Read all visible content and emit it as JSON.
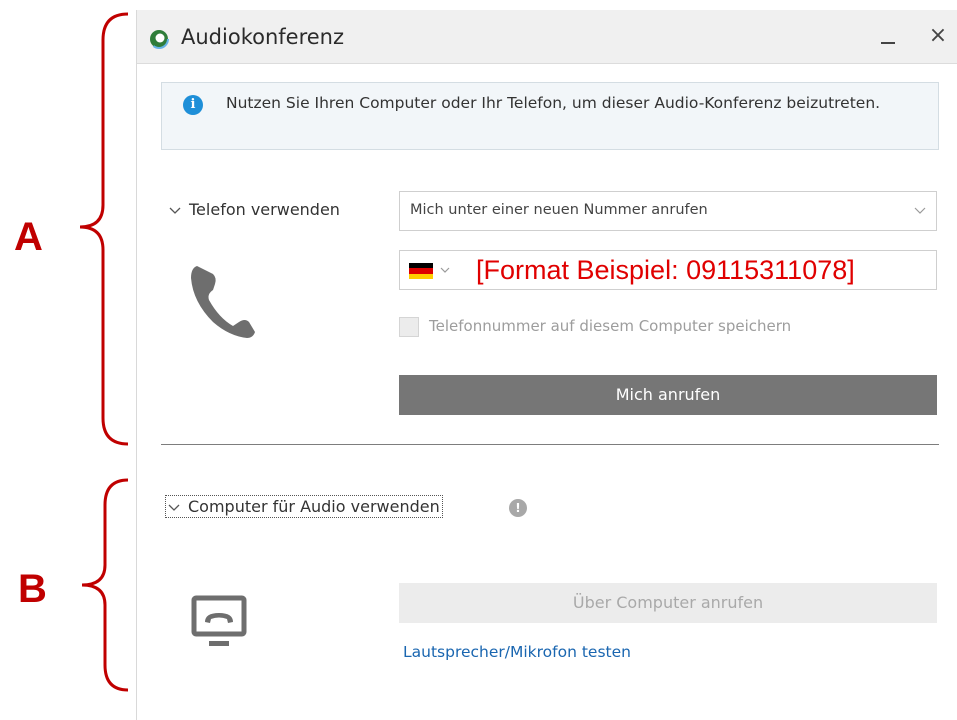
{
  "annotations": {
    "label_a": "A",
    "label_b": "B",
    "color": "#c00000"
  },
  "window": {
    "title": "Audiokonferenz",
    "logo_icon": "app-logo-icon",
    "close_glyph": "×"
  },
  "info": {
    "icon": "info-icon",
    "icon_glyph": "i",
    "text": "Nutzen Sie Ihren Computer oder Ihr Telefon, um dieser Audio-Konferenz beizutreten."
  },
  "phone_section": {
    "toggle_label": "Telefon verwenden",
    "option_selected": "Mich unter einer neuen Nummer anrufen",
    "country_flag": "germany-flag-icon",
    "phone_value": "[Format Beispiel: 09115311078]",
    "save_label": "Telefonnummer auf diesem Computer speichern",
    "save_checked": false,
    "call_button": "Mich anrufen"
  },
  "computer_section": {
    "toggle_label": "Computer für Audio verwenden",
    "help_glyph": "!",
    "call_button": "Über Computer anrufen",
    "test_link": "Lautsprecher/Mikrofon testen"
  },
  "colors": {
    "accent": "#1e8fd8",
    "button_dark": "#767676",
    "button_disabled": "#ececec",
    "link": "#1a66b0",
    "annotation_red": "#e00000"
  }
}
